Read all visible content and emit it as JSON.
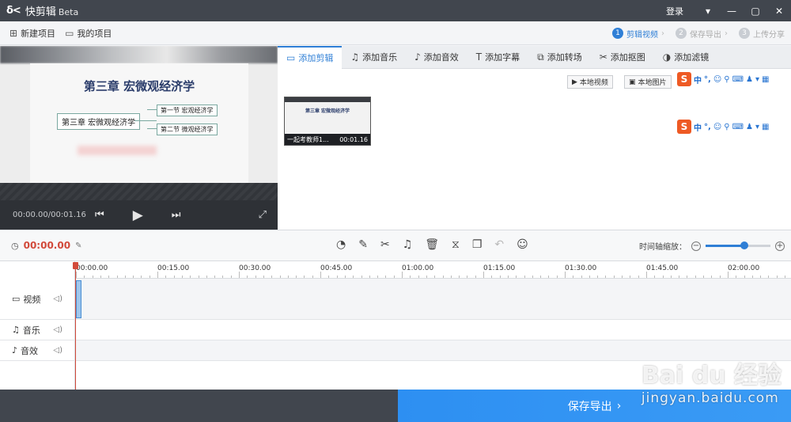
{
  "titlebar": {
    "logo_mark": "δ<",
    "app_name": "快剪辑",
    "beta": "Beta",
    "login": "登录",
    "menu_icon": "menu-icon",
    "minimize_icon": "minimize-icon",
    "maximize_icon": "maximize-icon",
    "close_icon": "close-icon"
  },
  "toolbar": {
    "new_project": "新建项目",
    "my_projects": "我的项目",
    "steps": [
      {
        "num": "1",
        "label": "剪辑视频"
      },
      {
        "num": "2",
        "label": "保存导出"
      },
      {
        "num": "3",
        "label": "上传分享"
      }
    ]
  },
  "preview": {
    "slide_title": "第三章 宏微观经济学",
    "mindmap_root": "第三章 宏微观经济学",
    "mindmap_children": [
      "第一节 宏观经济学",
      "第二节 微观经济学"
    ],
    "time_readout": "00:00.00/00:01.16"
  },
  "tabs": [
    {
      "label": "添加剪辑",
      "icon": "video-camera-icon"
    },
    {
      "label": "添加音乐",
      "icon": "music-note-icon"
    },
    {
      "label": "添加音效",
      "icon": "sound-effect-icon"
    },
    {
      "label": "添加字幕",
      "icon": "text-icon"
    },
    {
      "label": "添加转场",
      "icon": "transition-icon"
    },
    {
      "label": "添加抠图",
      "icon": "cutout-icon"
    },
    {
      "label": "添加滤镜",
      "icon": "filter-icon"
    }
  ],
  "media": {
    "local_video": "本地视频",
    "local_image": "本地图片",
    "thumb_title": "第三章 宏微观经济学",
    "thumb_name": "一起考教师1...",
    "thumb_duration": "00:01.16"
  },
  "ime": {
    "logo": "S",
    "lang": "中",
    "punct": "°,"
  },
  "timeline": {
    "current_time": "00:00.00",
    "zoom_label": "时间轴缩放：",
    "zoom_level": 0.6,
    "ruler": [
      "00:00.00",
      "00:15.00",
      "00:30.00",
      "00:45.00",
      "01:00.00",
      "01:15.00",
      "01:30.00",
      "01:45.00",
      "02:00.00"
    ],
    "tracks": [
      {
        "label": "视频",
        "icon": "video-camera-icon"
      },
      {
        "label": "音乐",
        "icon": "music-note-icon"
      },
      {
        "label": "音效",
        "icon": "sound-effect-icon"
      }
    ]
  },
  "bottom": {
    "export": "保存导出"
  },
  "watermark": {
    "main": "Bai du 经验",
    "sub": "jingyan.baidu.com"
  }
}
